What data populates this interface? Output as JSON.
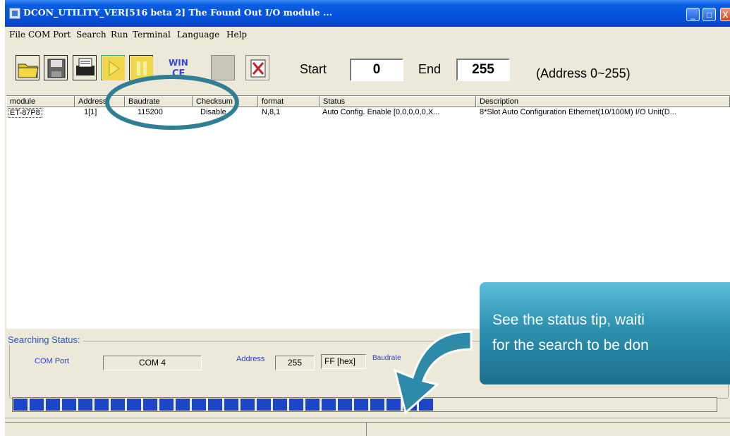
{
  "window": {
    "title": "DCON_UTILITY_VER[516 beta 2] The Found Out I/O module ..."
  },
  "menu": [
    "File",
    "COM Port",
    "Search",
    "Run",
    "Terminal",
    "Language",
    "Help"
  ],
  "toolbar": {
    "tools": [
      "open-folder-icon",
      "save-disk-icon",
      "printer-icon",
      "run-play-icon",
      "pause-icon",
      "wince-icon",
      "blank-button",
      "disconnect-icon"
    ],
    "wince_text": "WIN CE",
    "start_label": "Start",
    "start_value": "0",
    "end_label": "End",
    "end_value": "255",
    "range_note": "(Address 0~255)"
  },
  "table": {
    "columns": [
      "module",
      "Address",
      "Baudrate",
      "Checksum",
      "format",
      "Status",
      "Description"
    ],
    "rows": [
      [
        "ET-87P8",
        "1[1]",
        "115200",
        "Disable",
        "N,8,1",
        "Auto Config. Enable [0,0,0,0,0,X...",
        "8*Slot Auto Configuration Ethernet(10/100M) I/O Unit(D..."
      ]
    ]
  },
  "search_status": {
    "title": "Searching Status:",
    "com_port_label": "COM Port",
    "com_port_value": "COM 4",
    "address_label": "Address",
    "address_value": "255",
    "hex_value": "FF [hex]",
    "baudrate_label": "Baudrate",
    "progress_fraction": 0.6
  },
  "callout": {
    "line1": "See the status tip, waiti",
    "line2": "for the search to be don"
  },
  "colors": {
    "title_blue": "#0553dd",
    "highlight_circle": "#2e7f96",
    "callout_teal": "#2c91b0",
    "progress_blue": "#1e44c8",
    "label_blue": "#2c3cd6"
  }
}
